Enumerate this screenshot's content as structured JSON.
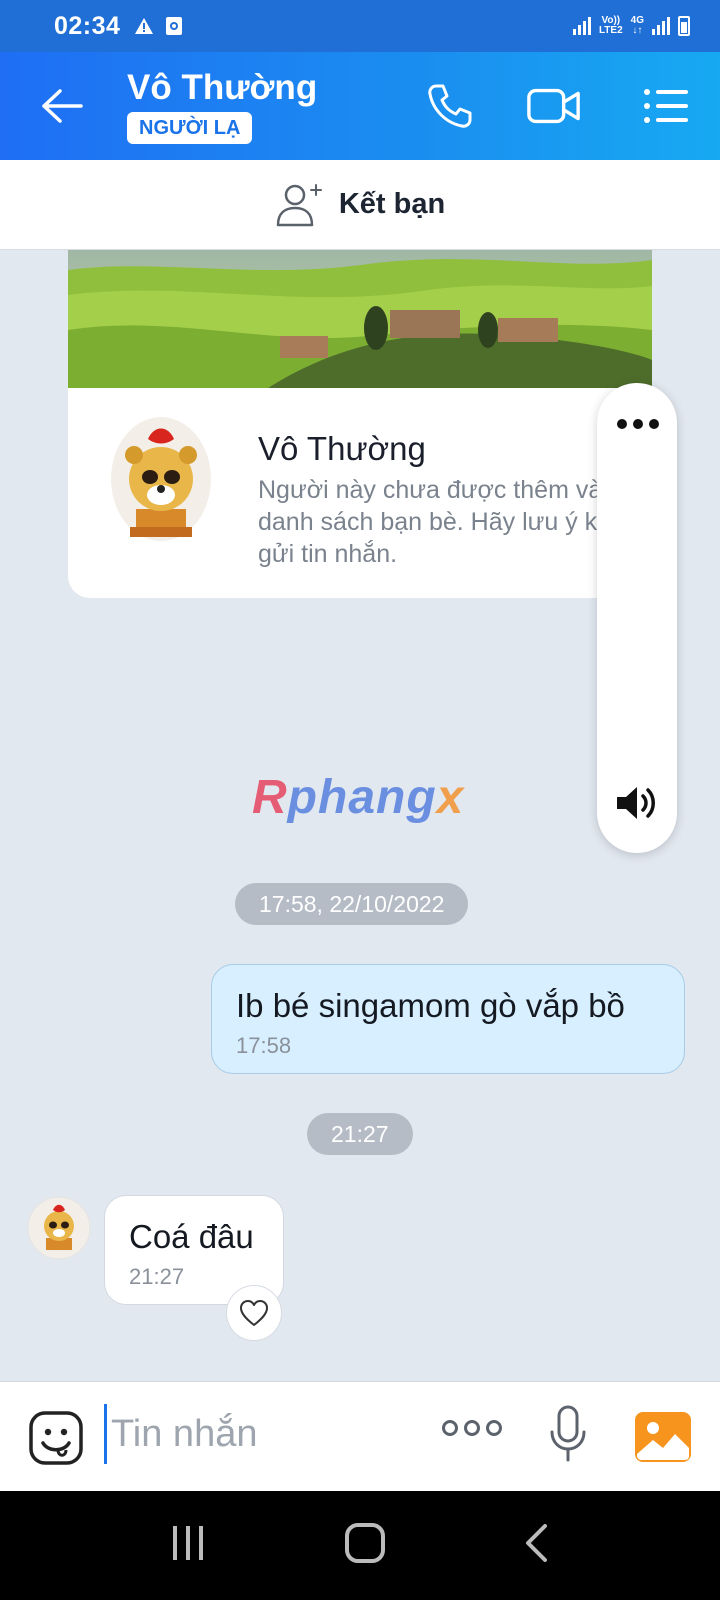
{
  "status_bar": {
    "time": "02:34",
    "network_top": "Vo))",
    "network_bottom": "LTE2",
    "network_type": "4G",
    "icons": [
      "alert-icon",
      "notification-icon",
      "signal-icon",
      "battery-icon"
    ]
  },
  "header": {
    "name": "Vô Thường",
    "badge": "NGƯỜI LẠ",
    "icons": [
      "back-arrow-icon",
      "phone-icon",
      "video-call-icon",
      "menu-icon"
    ]
  },
  "add_friend": {
    "label": "Kết bạn"
  },
  "profile_card": {
    "name": "Vô Thường",
    "note": "Người này chưa được thêm vào danh sách bạn bè. Hãy lưu ý khi gửi tin nhắn."
  },
  "watermark": {
    "part1": "R",
    "part2": "phang",
    "part3": "x"
  },
  "messages": {
    "time_divider_1": "17:58, 22/10/2022",
    "outgoing_text": "Ib bé singamom gò vắp bồ",
    "outgoing_time": "17:58",
    "time_divider_2": "21:27",
    "incoming_text": "Coá đâu",
    "incoming_time": "21:27"
  },
  "input": {
    "placeholder": "Tin nhắn"
  },
  "colors": {
    "header_start": "#1f6ef4",
    "header_end": "#17a9f2",
    "outgoing_bubble": "#d7efff",
    "chat_background": "#e2e8f0"
  }
}
